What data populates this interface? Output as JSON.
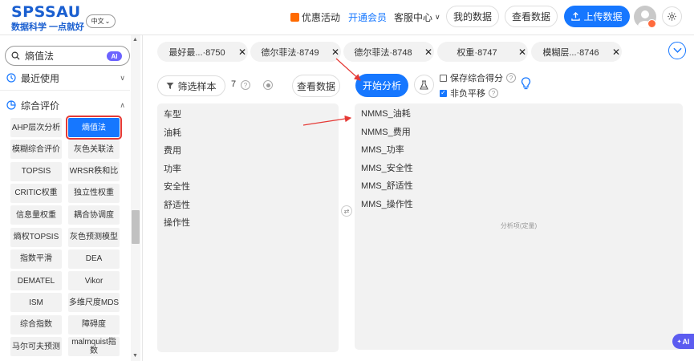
{
  "header": {
    "logo": "SPSSAU",
    "slogan": "数据科学 一点就好",
    "lang": "中文",
    "promo": "优惠活动",
    "member": "开通会员",
    "service": "客服中心",
    "mydata": "我的数据",
    "viewdata": "查看数据",
    "upload": "上传数据"
  },
  "sidebar": {
    "search_value": "熵值法",
    "ai": "AI",
    "recent": "最近使用",
    "category": "综合评价",
    "methods": [
      "AHP层次分析",
      "熵值法",
      "模糊综合评价",
      "灰色关联法",
      "TOPSIS",
      "WRSR秩和比",
      "CRITIC权重",
      "独立性权重",
      "信息量权重",
      "耦合协调度",
      "熵权TOPSIS",
      "灰色预测模型",
      "指数平滑",
      "DEA",
      "DEMATEL",
      "Vikor",
      "ISM",
      "多维尺度MDS",
      "综合指数",
      "障碍度",
      "马尔可夫预测",
      "malmquist指数"
    ],
    "selected_method": "熵值法"
  },
  "tabs": [
    {
      "name": "最好最...",
      "id": "·8750"
    },
    {
      "name": "德尔菲法",
      "id": "·8749"
    },
    {
      "name": "德尔菲法",
      "id": "·8748"
    },
    {
      "name": "权重",
      "id": "·8747"
    },
    {
      "name": "模糊层...",
      "id": "·8746"
    }
  ],
  "toolbar": {
    "filter": "筛选样本",
    "count": "7",
    "viewdata": "查看数据",
    "start": "开始分析",
    "save_score": "保存综合得分",
    "nonneg": "非负平移"
  },
  "variables": [
    "车型",
    "油耗",
    "费用",
    "功率",
    "安全性",
    "舒适性",
    "操作性"
  ],
  "analysis_items": [
    "NMMS_油耗",
    "NMMS_费用",
    "MMS_功率",
    "MMS_安全性",
    "MMS_舒适性",
    "MMS_操作性"
  ],
  "zone_label": "分析项(定量)",
  "ai_float": "AI",
  "colors": {
    "primary": "#1677ff",
    "brand": "#1a5fd0",
    "selected_border": "#e53935",
    "annotation": "#e53935"
  }
}
